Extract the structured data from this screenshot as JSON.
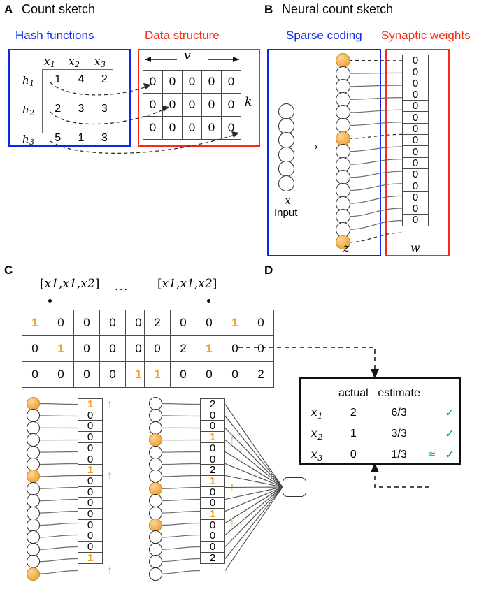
{
  "figure": {
    "panels": [
      {
        "letter": "A",
        "title": "Count sketch"
      },
      {
        "letter": "B",
        "title": "Neural count sketch"
      },
      {
        "letter": "C",
        "title": ""
      },
      {
        "letter": "D",
        "title": ""
      }
    ]
  },
  "colors": {
    "blue": "#0a29ef",
    "red": "#fa2a16",
    "orange": "#f49c20",
    "green": "#0aa64b",
    "black": "#000000"
  },
  "panelA": {
    "letter": "A",
    "title": "Count sketch",
    "hash_section_label": "Hash functions",
    "data_section_label": "Data structure",
    "hash_col_headers": [
      "x",
      "x",
      "x"
    ],
    "hash_col_header_subs": [
      "1",
      "2",
      "3"
    ],
    "hash_row_labels": [
      "h",
      "h",
      "h"
    ],
    "hash_row_label_subs": [
      "1",
      "2",
      "3"
    ],
    "hash_rows": [
      [
        "1",
        "4",
        "2"
      ],
      [
        "2",
        "3",
        "3"
      ],
      [
        "5",
        "1",
        "3"
      ]
    ],
    "width_label": "v",
    "height_label": "k",
    "sketch_rows": [
      [
        "0",
        "0",
        "0",
        "0",
        "0"
      ],
      [
        "0",
        "0",
        "0",
        "0",
        "0"
      ],
      [
        "0",
        "0",
        "0",
        "0",
        "0"
      ]
    ],
    "arrow_targets": [
      1,
      2,
      5
    ]
  },
  "panelB": {
    "letter": "B",
    "title": "Neural count sketch",
    "sparse_section_label": "Sparse coding",
    "synaptic_section_label": "Synaptic weights",
    "input_label": "Input",
    "input_var": "x",
    "input_neuron_count": 6,
    "z_label": "z",
    "w_label": "w",
    "z_neuron_count": 15,
    "z_active_indices": [
      1,
      7,
      15
    ],
    "w_values": [
      "0",
      "0",
      "0",
      "0",
      "0",
      "0",
      "0",
      "0",
      "0",
      "0",
      "0",
      "0",
      "0",
      "0",
      "0"
    ],
    "arrow_glyph": "→"
  },
  "panelC": {
    "letter": "C",
    "ellipsis": "...",
    "left_input_label": "[x , x , x ]",
    "left_input_tokens": [
      "[",
      "x",
      "1",
      ",",
      "x",
      "1",
      ",",
      "x",
      "2",
      "]"
    ],
    "right_input_tokens": [
      "[",
      "x",
      "1",
      ",",
      "x",
      "1",
      ",",
      "x",
      "2",
      "]"
    ],
    "left_matrix": {
      "rows": [
        [
          "1",
          "0",
          "0",
          "0",
          "0"
        ],
        [
          "0",
          "1",
          "0",
          "0",
          "0"
        ],
        [
          "0",
          "0",
          "0",
          "0",
          "1"
        ]
      ],
      "highlight": [
        [
          0,
          0
        ],
        [
          1,
          1
        ],
        [
          2,
          4
        ]
      ]
    },
    "right_matrix": {
      "rows": [
        [
          "2",
          "0",
          "0",
          "1",
          "0"
        ],
        [
          "0",
          "2",
          "1",
          "0",
          "0"
        ],
        [
          "1",
          "0",
          "0",
          "0",
          "2"
        ]
      ],
      "highlight": [
        [
          0,
          3
        ],
        [
          1,
          2
        ],
        [
          2,
          0
        ]
      ]
    },
    "left_network": {
      "neuron_count": 15,
      "active_indices": [
        1,
        7,
        15
      ],
      "weights": [
        "1",
        "0",
        "0",
        "0",
        "0",
        "0",
        "1",
        "0",
        "0",
        "0",
        "0",
        "0",
        "0",
        "0",
        "1"
      ],
      "highlight_indices": [
        1,
        7,
        15
      ],
      "arrow_indices": [
        1,
        7,
        15
      ]
    },
    "right_network": {
      "neuron_count": 15,
      "active_indices": [
        4,
        8,
        11
      ],
      "weights": [
        "2",
        "0",
        "0",
        "1",
        "0",
        "0",
        "2",
        "1",
        "0",
        "0",
        "1",
        "0",
        "0",
        "0",
        "2"
      ],
      "highlight_indices": [
        4,
        8,
        11
      ],
      "arrow_indices": [
        4,
        8,
        11
      ]
    },
    "up_arrow_glyph": "↑"
  },
  "panelD": {
    "letter": "D",
    "headers": [
      "actual",
      "estimate"
    ],
    "rows": [
      {
        "var": "x",
        "sub": "1",
        "actual": "2",
        "estimate": "6/3",
        "approx": "",
        "check": "✓"
      },
      {
        "var": "x",
        "sub": "2",
        "actual": "1",
        "estimate": "3/3",
        "approx": "",
        "check": "✓"
      },
      {
        "var": "x",
        "sub": "3",
        "actual": "0",
        "estimate": "1/3",
        "approx": "≈",
        "check": "✓"
      }
    ]
  }
}
